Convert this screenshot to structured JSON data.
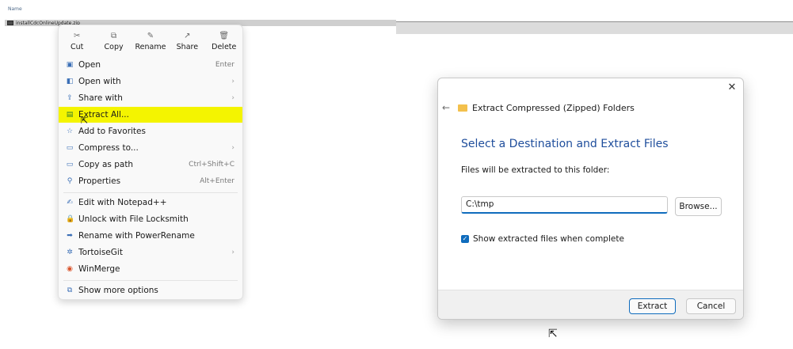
{
  "explorer": {
    "column_header": "Name",
    "file_name": "installCdcOnlineUpdate.zip"
  },
  "context_menu": {
    "top_actions": [
      {
        "label": "Cut",
        "icon": "cut-icon",
        "glyph": "✂"
      },
      {
        "label": "Copy",
        "icon": "copy-icon",
        "glyph": "⧉"
      },
      {
        "label": "Rename",
        "icon": "rename-icon",
        "glyph": "✎"
      },
      {
        "label": "Share",
        "icon": "share-icon",
        "glyph": "↗"
      },
      {
        "label": "Delete",
        "icon": "delete-icon",
        "glyph": "🗑"
      }
    ],
    "items": [
      {
        "label": "Open",
        "shortcut": "Enter",
        "icon": "zip-file-icon",
        "glyph": "▣"
      },
      {
        "label": "Open with",
        "submenu": true,
        "icon": "open-with-icon",
        "glyph": "◧"
      },
      {
        "label": "Share with",
        "submenu": true,
        "icon": "share-with-icon",
        "glyph": "⇪"
      },
      {
        "label": "Extract All...",
        "highlighted": true,
        "icon": "extract-icon",
        "glyph": "▤"
      },
      {
        "label": "Add to Favorites",
        "icon": "star-icon",
        "glyph": "☆"
      },
      {
        "label": "Compress to...",
        "submenu": true,
        "icon": "compress-icon",
        "glyph": "▭"
      },
      {
        "label": "Copy as path",
        "shortcut": "Ctrl+Shift+C",
        "icon": "copy-path-icon",
        "glyph": "▭"
      },
      {
        "label": "Properties",
        "shortcut": "Alt+Enter",
        "icon": "properties-icon",
        "glyph": "⚲"
      },
      {
        "label": "Edit with Notepad++",
        "icon": "notepad-icon",
        "glyph": "✍"
      },
      {
        "label": "Unlock with File Locksmith",
        "icon": "lock-icon",
        "glyph": "🔒"
      },
      {
        "label": "Rename with PowerRename",
        "icon": "power-rename-icon",
        "glyph": "➡"
      },
      {
        "label": "TortoiseGit",
        "submenu": true,
        "icon": "tortoisegit-icon",
        "glyph": "✲"
      },
      {
        "label": "WinMerge",
        "icon": "winmerge-icon",
        "glyph": "◉"
      },
      {
        "label": "Show more options",
        "icon": "more-options-icon",
        "glyph": "⧉"
      }
    ],
    "submenu_glyph": "›",
    "highlight_color": "#f4f400"
  },
  "dialog": {
    "close_glyph": "✕",
    "back_glyph": "←",
    "title": "Extract Compressed (Zipped) Folders",
    "heading": "Select a Destination and Extract Files",
    "subtext": "Files will be extracted to this folder:",
    "path_value": "C:\\tmp",
    "browse_label": "Browse...",
    "checkbox_checked": true,
    "checkbox_label": "Show extracted files when complete",
    "extract_label": "Extract",
    "cancel_label": "Cancel",
    "accent_color": "#0f6cbd",
    "heading_color": "#1f4e9c"
  },
  "cursor_glyph": "⇱"
}
